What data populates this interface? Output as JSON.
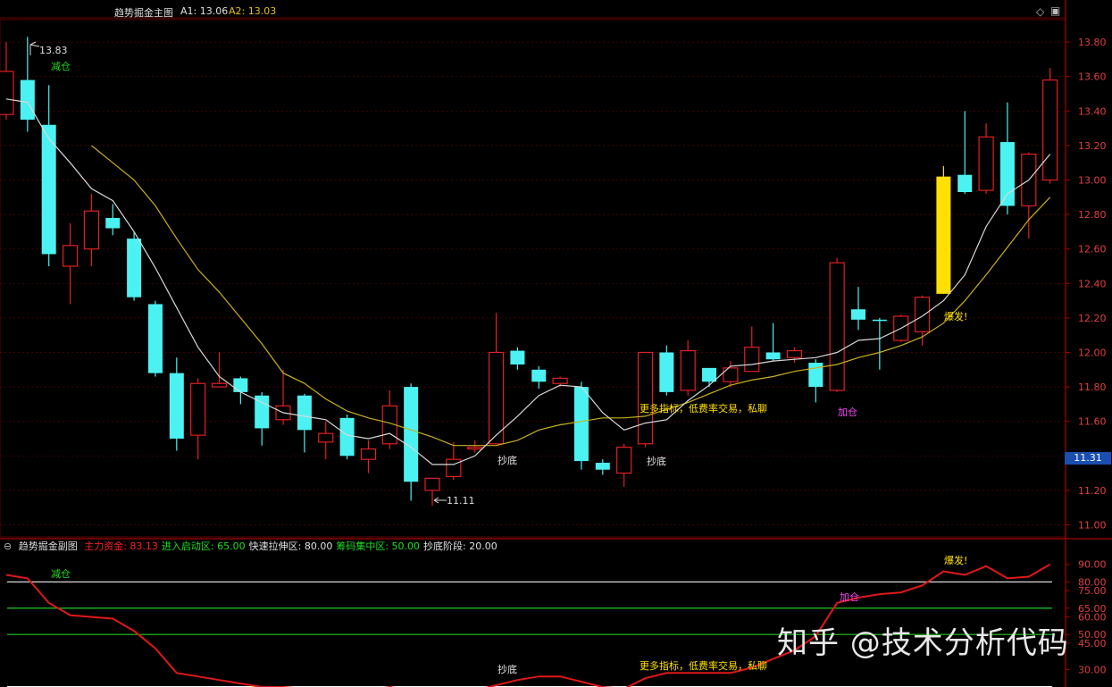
{
  "main": {
    "title": "趋势掘金主图",
    "a1_label": "A1: 13.06",
    "a2_label": "A2: 13.03",
    "high_marker": "13.83",
    "low_marker": "11.11",
    "current_price": "11.31"
  },
  "sub": {
    "title": "趋势掘金副图",
    "items": [
      {
        "label": "主力资金: 83.13",
        "color": "#ff2020"
      },
      {
        "label": "进入启动区: 65.00",
        "color": "#22dd22"
      },
      {
        "label": "快速拉伸区: 80.00",
        "color": "#e0e0e0"
      },
      {
        "label": "筹码集中区: 50.00",
        "color": "#22dd22"
      },
      {
        "label": "抄底阶段: 20.00",
        "color": "#e0e0e0"
      }
    ]
  },
  "watermark": "知乎 @技术分析代码",
  "icons": [
    "collapse-icon",
    "settings-diamond-icon",
    "window-icon"
  ],
  "colors": {
    "up": "#e02020",
    "down": "#4cf2f2",
    "burst": "#ffe000",
    "ma5": "#d8d8d8",
    "ma10": "#c8b020",
    "grid": "#5a0000"
  },
  "chart_data": [
    {
      "type": "candlestick",
      "y_ticks": [
        11.0,
        11.2,
        11.4,
        11.6,
        11.8,
        12.0,
        12.2,
        12.4,
        12.6,
        12.8,
        13.0,
        13.2,
        13.4,
        13.6,
        13.8
      ],
      "ylim": [
        10.93,
        13.93
      ],
      "candles": [
        {
          "o": 13.38,
          "c": 13.63,
          "h": 13.8,
          "l": 13.35
        },
        {
          "o": 13.58,
          "c": 13.35,
          "h": 13.83,
          "l": 13.28
        },
        {
          "o": 13.32,
          "c": 12.57,
          "h": 13.55,
          "l": 12.5
        },
        {
          "o": 12.5,
          "c": 12.62,
          "h": 12.75,
          "l": 12.28
        },
        {
          "o": 12.6,
          "c": 12.82,
          "h": 12.92,
          "l": 12.5
        },
        {
          "o": 12.78,
          "c": 12.72,
          "h": 12.86,
          "l": 12.68
        },
        {
          "o": 12.66,
          "c": 12.32,
          "h": 12.7,
          "l": 12.3
        },
        {
          "o": 12.28,
          "c": 11.88,
          "h": 12.3,
          "l": 11.86
        },
        {
          "o": 11.88,
          "c": 11.5,
          "h": 11.97,
          "l": 11.43
        },
        {
          "o": 11.52,
          "c": 11.82,
          "h": 11.85,
          "l": 11.38
        },
        {
          "o": 11.8,
          "c": 11.82,
          "h": 12.0,
          "l": 11.8
        },
        {
          "o": 11.85,
          "c": 11.77,
          "h": 11.86,
          "l": 11.7
        },
        {
          "o": 11.75,
          "c": 11.56,
          "h": 11.77,
          "l": 11.46
        },
        {
          "o": 11.61,
          "c": 11.69,
          "h": 11.9,
          "l": 11.58
        },
        {
          "o": 11.75,
          "c": 11.55,
          "h": 11.76,
          "l": 11.42
        },
        {
          "o": 11.48,
          "c": 11.53,
          "h": 11.6,
          "l": 11.38
        },
        {
          "o": 11.62,
          "c": 11.4,
          "h": 11.64,
          "l": 11.38
        },
        {
          "o": 11.38,
          "c": 11.44,
          "h": 11.49,
          "l": 11.3
        },
        {
          "o": 11.47,
          "c": 11.69,
          "h": 11.78,
          "l": 11.44
        },
        {
          "o": 11.8,
          "c": 11.25,
          "h": 11.82,
          "l": 11.14
        },
        {
          "o": 11.2,
          "c": 11.27,
          "h": 11.27,
          "l": 11.11
        },
        {
          "o": 11.28,
          "c": 11.38,
          "h": 11.48,
          "l": 11.26
        },
        {
          "o": 11.44,
          "c": 11.45,
          "h": 11.49,
          "l": 11.42
        },
        {
          "o": 11.47,
          "c": 12.0,
          "h": 12.23,
          "l": 11.47
        },
        {
          "o": 12.01,
          "c": 11.93,
          "h": 12.03,
          "l": 11.9
        },
        {
          "o": 11.9,
          "c": 11.83,
          "h": 11.92,
          "l": 11.79
        },
        {
          "o": 11.82,
          "c": 11.85,
          "h": 11.86,
          "l": 11.8
        },
        {
          "o": 11.8,
          "c": 11.37,
          "h": 11.83,
          "l": 11.32
        },
        {
          "o": 11.36,
          "c": 11.32,
          "h": 11.38,
          "l": 11.29
        },
        {
          "o": 11.3,
          "c": 11.45,
          "h": 11.47,
          "l": 11.22
        },
        {
          "o": 11.47,
          "c": 12.0,
          "h": 12.0,
          "l": 11.45
        },
        {
          "o": 12.0,
          "c": 11.77,
          "h": 12.04,
          "l": 11.75
        },
        {
          "o": 11.78,
          "c": 12.01,
          "h": 12.07,
          "l": 11.75
        },
        {
          "o": 11.91,
          "c": 11.83,
          "h": 11.91,
          "l": 11.8
        },
        {
          "o": 11.83,
          "c": 11.91,
          "h": 11.95,
          "l": 11.8
        },
        {
          "o": 11.89,
          "c": 12.03,
          "h": 12.15,
          "l": 11.89
        },
        {
          "o": 12.0,
          "c": 11.96,
          "h": 12.17,
          "l": 11.95
        },
        {
          "o": 11.97,
          "c": 12.01,
          "h": 12.03,
          "l": 11.94
        },
        {
          "o": 11.94,
          "c": 11.8,
          "h": 11.96,
          "l": 11.71
        },
        {
          "o": 11.78,
          "c": 12.52,
          "h": 12.55,
          "l": 11.77
        },
        {
          "o": 12.25,
          "c": 12.19,
          "h": 12.38,
          "l": 12.13
        },
        {
          "o": 12.19,
          "c": 12.19,
          "h": 12.2,
          "l": 11.9
        },
        {
          "o": 12.07,
          "c": 12.21,
          "h": 12.22,
          "l": 12.06
        },
        {
          "o": 12.12,
          "c": 12.32,
          "h": 12.33,
          "l": 12.04
        },
        {
          "o": 12.34,
          "c": 13.02,
          "h": 13.08,
          "l": 12.34
        },
        {
          "o": 13.03,
          "c": 12.93,
          "h": 13.4,
          "l": 12.92
        },
        {
          "o": 12.94,
          "c": 13.25,
          "h": 13.33,
          "l": 12.92
        },
        {
          "o": 13.22,
          "c": 12.85,
          "h": 13.45,
          "l": 12.8
        },
        {
          "o": 12.85,
          "c": 13.15,
          "h": 13.16,
          "l": 12.66
        },
        {
          "o": 13.0,
          "c": 13.58,
          "h": 13.65,
          "l": 12.98
        }
      ],
      "ma5": [
        13.47,
        13.45,
        13.24,
        13.1,
        12.95,
        12.88,
        12.7,
        12.49,
        12.26,
        12.03,
        11.86,
        11.77,
        11.71,
        11.65,
        11.63,
        11.61,
        11.52,
        11.5,
        11.53,
        11.45,
        11.35,
        11.35,
        11.4,
        11.52,
        11.63,
        11.75,
        11.81,
        11.8,
        11.65,
        11.55,
        11.59,
        11.61,
        11.72,
        11.81,
        11.92,
        11.93,
        11.95,
        11.96,
        11.97,
        12.0,
        12.07,
        12.08,
        12.14,
        12.21,
        12.3,
        12.45,
        12.73,
        12.92,
        13.0,
        13.15
      ],
      "ma10": [
        null,
        null,
        null,
        null,
        13.2,
        13.1,
        13.0,
        12.85,
        12.66,
        12.48,
        12.35,
        12.2,
        12.05,
        11.88,
        11.82,
        11.73,
        11.66,
        11.62,
        11.59,
        11.55,
        11.51,
        11.46,
        11.46,
        11.46,
        11.49,
        11.55,
        11.58,
        11.6,
        11.62,
        11.62,
        11.63,
        11.67,
        11.71,
        11.76,
        11.81,
        11.84,
        11.86,
        11.89,
        11.91,
        11.93,
        11.97,
        12.0,
        12.04,
        12.09,
        12.17,
        12.3,
        12.45,
        12.61,
        12.77,
        12.9
      ],
      "annotations": [
        "减仓",
        "抄底",
        "抄底",
        "更多指标，低费率交易，私聊",
        "加仓",
        "爆发!"
      ]
    },
    {
      "type": "line",
      "name": "主力资金",
      "y_ticks": [
        30,
        45,
        50,
        60,
        65,
        75,
        80,
        90
      ],
      "ylim": [
        20,
        97
      ],
      "reference_lines": [
        80,
        65,
        50,
        20
      ],
      "values": [
        84,
        82,
        68,
        61,
        60,
        59,
        52,
        42,
        28,
        26,
        24,
        22,
        20,
        20,
        19,
        19,
        18,
        18,
        20,
        18,
        17,
        17,
        18,
        21,
        24,
        26,
        26,
        23,
        20,
        19,
        25,
        28,
        28,
        28,
        28,
        31,
        36,
        41,
        49,
        68,
        71,
        73,
        74,
        78,
        86,
        84,
        89,
        82,
        83,
        90
      ],
      "annotations": [
        "减仓",
        "抄底",
        "更多指标，低费率交易，私聊",
        "加仓",
        "爆发!"
      ]
    }
  ]
}
